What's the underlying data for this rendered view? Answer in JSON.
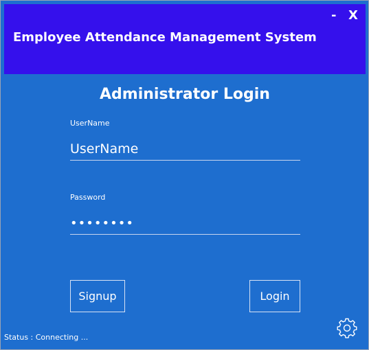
{
  "window": {
    "title": "Employee Attendance Management System",
    "minimize_label": "-",
    "close_label": "X"
  },
  "login": {
    "heading": "Administrator Login",
    "username_label": "UserName",
    "username_placeholder": "UserName",
    "username_value": "",
    "password_label": "Password",
    "password_value": "password"
  },
  "buttons": {
    "signup_label": "Signup",
    "login_label": "Login"
  },
  "icons": {
    "settings": "gear-icon"
  },
  "status": {
    "text": "Status : Connecting ..."
  },
  "colors": {
    "title_bar": "#3510ec",
    "background": "#1e6ecf",
    "text": "#ffffff"
  }
}
